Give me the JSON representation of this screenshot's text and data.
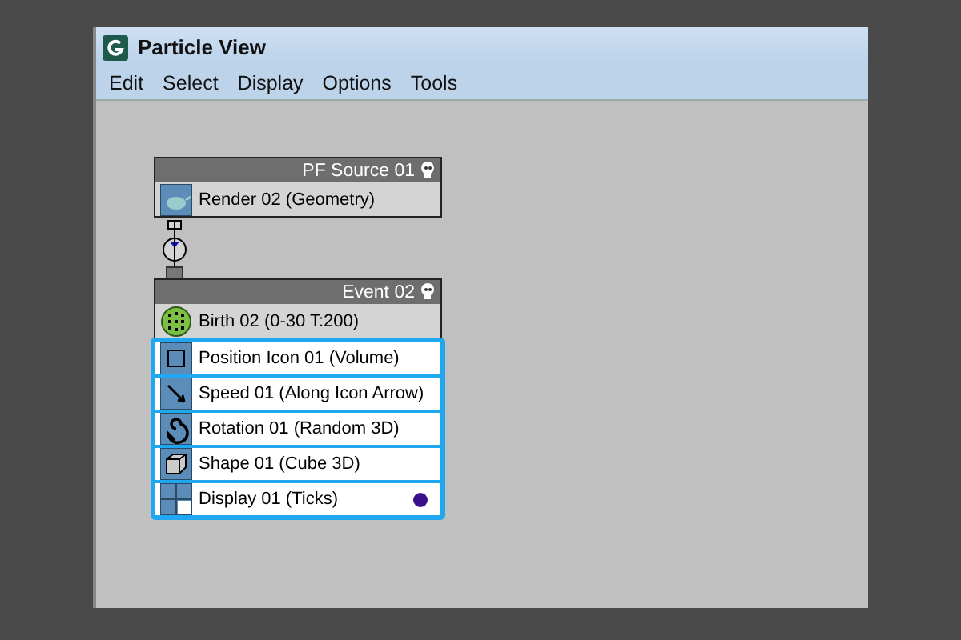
{
  "window": {
    "title": "Particle View"
  },
  "menu": [
    "Edit",
    "Select",
    "Display",
    "Options",
    "Tools"
  ],
  "nodes": [
    {
      "title": "PF Source 01",
      "operators": [
        {
          "label": "Render 02 (Geometry)",
          "kind": "render",
          "selected": false
        }
      ]
    },
    {
      "title": "Event 02",
      "operators": [
        {
          "label": "Birth 02 (0-30 T:200)",
          "kind": "birth",
          "selected": false
        },
        {
          "label": "Position Icon 01 (Volume)",
          "kind": "position",
          "selected": true
        },
        {
          "label": "Speed 01 (Along Icon Arrow)",
          "kind": "speed",
          "selected": true
        },
        {
          "label": "Rotation 01 (Random 3D)",
          "kind": "rotation",
          "selected": true
        },
        {
          "label": "Shape 01 (Cube 3D)",
          "kind": "shape",
          "selected": true
        },
        {
          "label": "Display 01 (Ticks)",
          "kind": "display",
          "selected": true,
          "color": "#3a0f8c"
        }
      ]
    }
  ]
}
